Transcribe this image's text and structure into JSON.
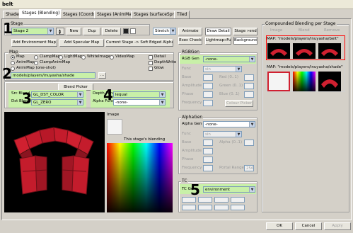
{
  "window": {
    "title": "belt"
  },
  "tabs": [
    "Shader",
    "Stages (Blending)",
    "Stages (Coords)",
    "Stages (AnimMap)",
    "Stages (surfaceSprites)",
    "Tiled"
  ],
  "stage": {
    "group_label": "Stage",
    "value": "Stage 2",
    "new": "New",
    "dup": "Dup",
    "delete": "Delete"
  },
  "toolbar": {
    "stretch": "Stretch",
    "animate": "Animate",
    "draw_detail": "Draw Detail",
    "stage_send": "Stage »end",
    "exec_check": "Exec Check",
    "lightmap_full": "Lightmap»Full",
    "background": "Background"
  },
  "add": {
    "env_map": "Add Environment Map",
    "specular": "Add Specular Map",
    "soft_alpha": "Current Stage -> Soft Edged Alpha"
  },
  "map": {
    "group_label": "Map",
    "radios": [
      "Map",
      "ClampMap",
      "LightMap",
      "WhiteImage",
      "VideoMap",
      "AnimMap",
      "ClampAnimMap",
      "AnimMap (one-shot)"
    ],
    "path": "models/players/inuyasha/shade",
    "browse": "...",
    "detail": "Detail",
    "depthwrite": "DepthWrite",
    "glow": "Glow"
  },
  "blend": {
    "picker": "Blend Picker",
    "src_label": "Src Blend",
    "src_value": "GL_DST_COLOR",
    "dst_label": "Dst Blend",
    "dst_value": "GL_ZERO",
    "depth_label": "Depth Func",
    "depth_value": "lequal",
    "alpha_label": "Alpha Func",
    "alpha_value": "-none-"
  },
  "rgbgen": {
    "group_label": "RGBGen",
    "gen_label": "RGB Gen",
    "gen_value": "-none-",
    "func": "Func",
    "func_value": "sin",
    "base": "Base",
    "amplitude": "Amplitude",
    "phase": "Phase",
    "frequency": "Frequency",
    "red": "Red (0..1)",
    "green": "Green (0..1)",
    "blue": "Blue (0..1)",
    "color_picker": "Colour Picker"
  },
  "alphagen": {
    "group_label": "AlphaGen",
    "gen_label": "Alpha Gen",
    "gen_value": "-none-",
    "func": "Func",
    "func_value": "sin",
    "base": "Base",
    "amplitude": "Amplitude",
    "phase": "Phase",
    "frequency": "Frequency",
    "alpha": "Alpha (0..1)",
    "portal": "Portal Range",
    "portal_value": "256"
  },
  "tc": {
    "group_label": "TC",
    "gen_label": "TC Gen",
    "gen_value": "environment"
  },
  "image": {
    "label": "Image",
    "blend_label": "This stage's blending"
  },
  "compound": {
    "group_label": "Compounded Blending per Stage",
    "col_image": "Image",
    "col_blend": "Blend",
    "col_remove": "Remove",
    "map1": "MAP:  \"models/players/inuyasha/belt\"",
    "map2": "MAP:  \"models/players/inuyasha/shade\""
  },
  "bottom": {
    "ok": "OK",
    "cancel": "Cancel",
    "apply": "Apply"
  },
  "annotations": [
    "1",
    "2",
    "3",
    "4",
    "5"
  ],
  "colors": {
    "accent": "#316ac5",
    "green_field": "#c8f0a8",
    "preview_red": "#d02030"
  }
}
